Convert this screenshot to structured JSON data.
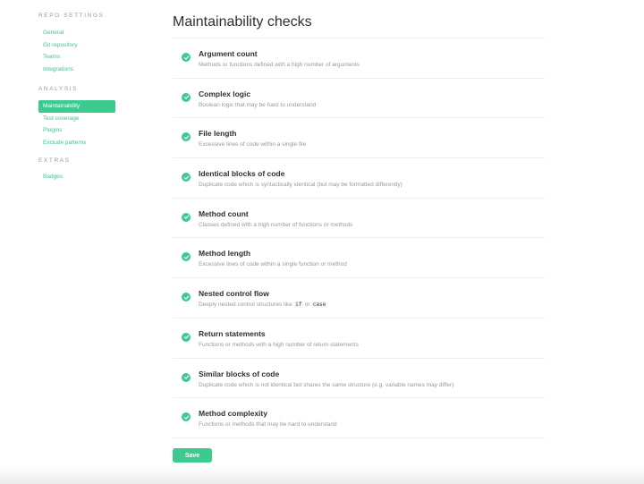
{
  "sidebar": {
    "repo_settings": {
      "heading": "REPO SETTINGS",
      "items": [
        "General",
        "Git repository",
        "Teams",
        "Integrations"
      ]
    },
    "analysis": {
      "heading": "ANALYSIS",
      "items": [
        "Maintainability",
        "Test coverage",
        "Plugins",
        "Exclude patterns"
      ],
      "active": "Maintainability"
    },
    "extras": {
      "heading": "EXTRAS",
      "items": [
        "Badges"
      ]
    }
  },
  "main": {
    "title": "Maintainability checks",
    "checks": [
      {
        "title": "Argument count",
        "desc": "Methods or functions defined with a high number of arguments",
        "checked": true
      },
      {
        "title": "Complex logic",
        "desc": "Boolean logic that may be hard to understand",
        "checked": true
      },
      {
        "title": "File length",
        "desc": "Excessive lines of code within a single file",
        "checked": true
      },
      {
        "title": "Identical blocks of code",
        "desc": "Duplicate code which is syntactically identical (but may be formatted differently)",
        "checked": true
      },
      {
        "title": "Method count",
        "desc": "Classes defined with a high number of functions or methods",
        "checked": true
      },
      {
        "title": "Method length",
        "desc": "Excessive lines of code within a single function or method",
        "checked": true
      },
      {
        "title": "Nested control flow",
        "desc_prefix": "Deeply nested control structures like",
        "code1": "if",
        "desc_join": "or",
        "code2": "case",
        "checked": true
      },
      {
        "title": "Return statements",
        "desc": "Functions or methods with a high number of return statements",
        "checked": true
      },
      {
        "title": "Similar blocks of code",
        "desc": "Duplicate code which is not identical but shares the same structure (e.g. variable names may differ)",
        "checked": true
      },
      {
        "title": "Method complexity",
        "desc": "Functions or methods that may be hard to understand",
        "checked": true
      }
    ],
    "save_label": "Save"
  },
  "colors": {
    "accent": "#3dca8f",
    "link": "#3fc590",
    "muted": "#999999"
  },
  "icons": {
    "check": "check-icon"
  }
}
